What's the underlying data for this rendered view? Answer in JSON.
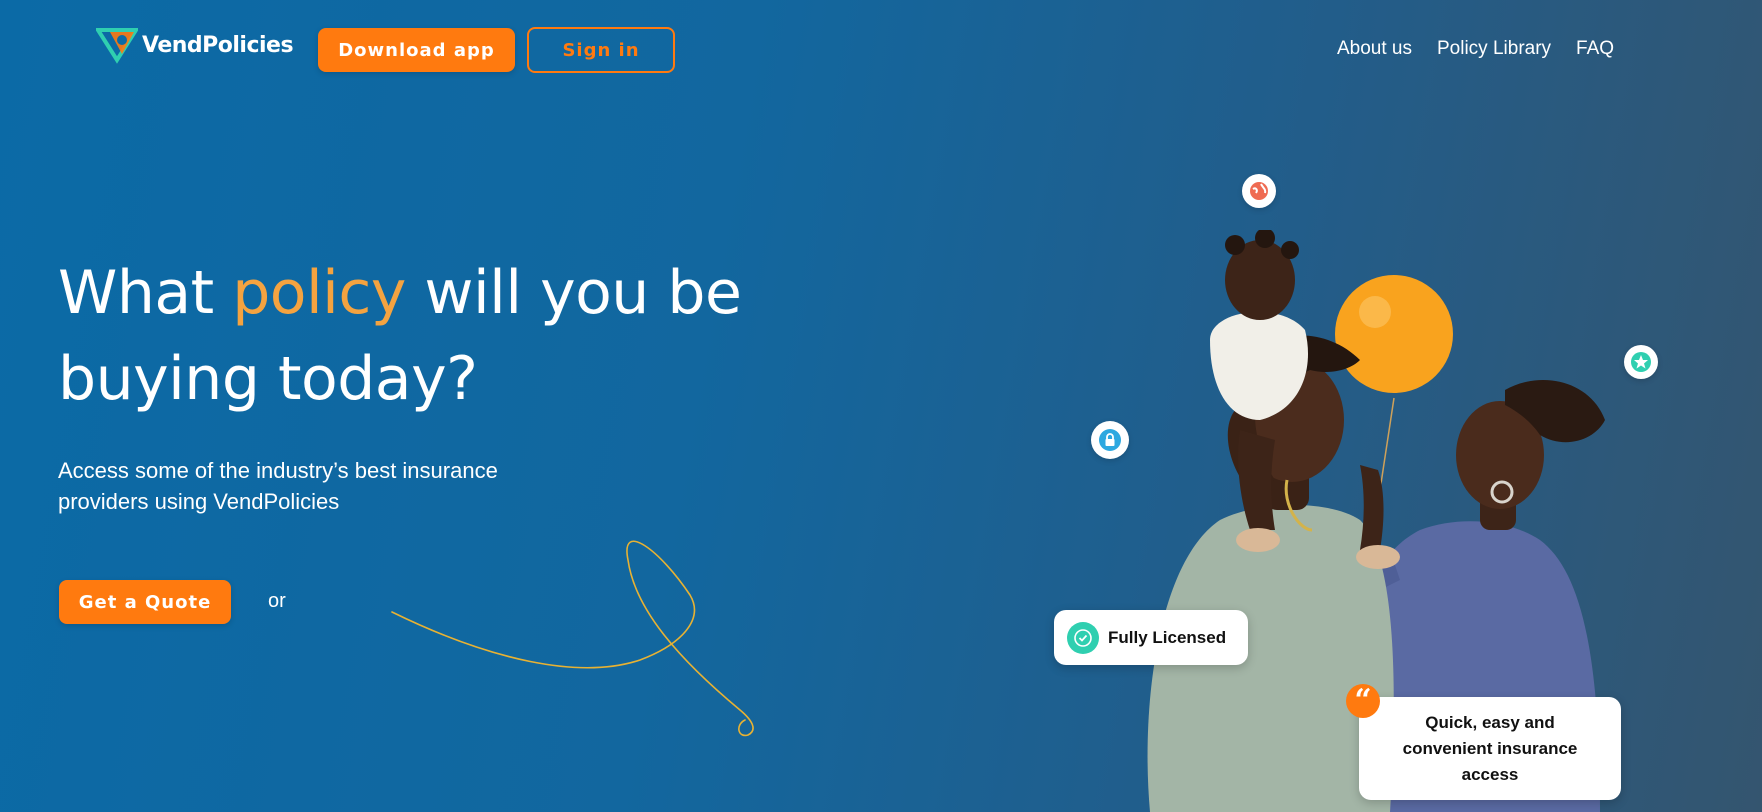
{
  "header": {
    "logo": {
      "text_part1": "Vend",
      "text_part2": "Policies"
    },
    "download_label": "Download app",
    "signin_label": "Sign in",
    "nav": [
      "About us",
      "Policy Library",
      "FAQ"
    ]
  },
  "hero": {
    "headline_1": "What ",
    "headline_accent": "policy",
    "headline_2": " will you be",
    "headline_3": "buying today?",
    "subtext_1": "Access some of the industry’s best insurance",
    "subtext_2": "providers using VendPolicies",
    "cta_label": "Get a Quote",
    "or_label": "or"
  },
  "badges": {
    "licensed_label": "Fully Licensed",
    "quote_text_1": "Quick, easy and",
    "quote_text_2": "convenient insurance",
    "quote_text_3": "access",
    "quote_mark": "“"
  },
  "colors": {
    "accent": "#ff7a0f",
    "headline_accent": "#f4a340",
    "teal": "#2fcfb0",
    "bg_start": "#0b6aa6",
    "bg_end": "#34556f"
  },
  "icons": [
    "logo-icon",
    "globe-icon",
    "lock-icon",
    "star-icon",
    "check-badge-icon",
    "quote-icon"
  ]
}
